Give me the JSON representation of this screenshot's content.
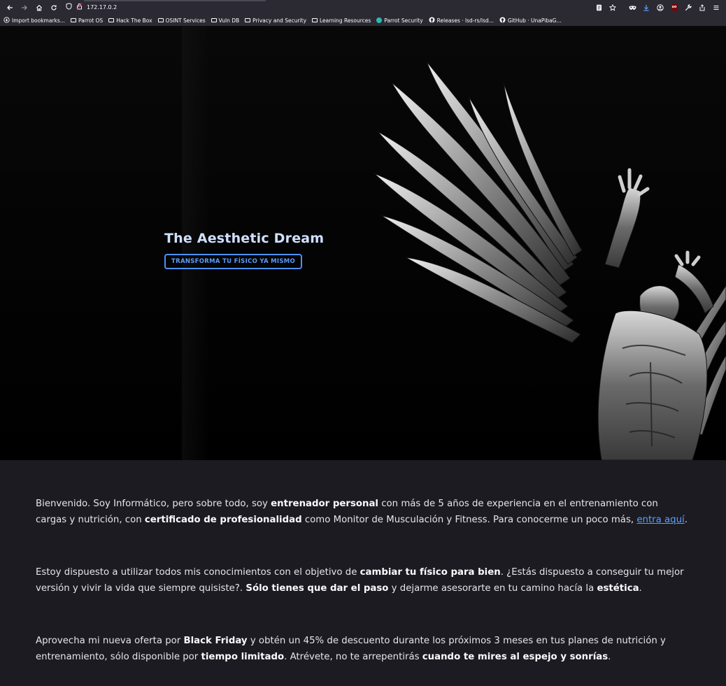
{
  "browser": {
    "url": "172.17.0.2",
    "nav": {
      "back_icon": "arrow-left-icon",
      "forward_icon": "arrow-right-icon",
      "home_icon": "home-icon",
      "reload_icon": "reload-icon"
    },
    "bookmarks": [
      {
        "label": "Import bookmarks...",
        "icon": "import-icon"
      },
      {
        "label": "Parrot OS",
        "icon": "folder-icon"
      },
      {
        "label": "Hack The Box",
        "icon": "folder-icon"
      },
      {
        "label": "OSINT Services",
        "icon": "folder-icon"
      },
      {
        "label": "Vuln DB",
        "icon": "folder-icon"
      },
      {
        "label": "Privacy and Security",
        "icon": "folder-icon"
      },
      {
        "label": "Learning Resources",
        "icon": "folder-icon"
      },
      {
        "label": "Parrot Security",
        "icon": "parrot-icon"
      },
      {
        "label": "Releases · lsd-rs/lsd...",
        "icon": "github-icon"
      },
      {
        "label": "GitHub · UnaPibaG...",
        "icon": "github-icon"
      }
    ],
    "toolbar_icons": [
      "reader-icon",
      "star-icon",
      "mask-icon",
      "download-icon",
      "account-icon",
      "ublock-icon",
      "wrench-icon",
      "share-icon",
      "menu-icon"
    ]
  },
  "hero": {
    "title": "The Aesthetic Dream",
    "cta": "TRANSFORMA TU FÍSICO YA MISMO"
  },
  "content": {
    "p1": {
      "t1": "Bienvenido. Soy Informático, pero sobre todo, soy ",
      "b1": "entrenador personal",
      "t2": " con más de 5 años de experiencia en el entrenamiento con cargas y nutrición, con ",
      "b2": "certificado de profesionalidad",
      "t3": " como Monitor de Musculación y Fitness. Para conocerme un poco más, ",
      "link": "entra aquí",
      "t4": "."
    },
    "p2": {
      "t1": "Estoy dispuesto a utilizar todos mis conocimientos con el objetivo de ",
      "b1": "cambiar tu físico para bien",
      "t2": ". ¿Estás dispuesto a conseguir tu mejor versión y vivir la vida que siempre quisiste?. ",
      "b2": "Sólo tienes que dar el paso",
      "t3": " y dejarme asesorarte en tu camino hacía la ",
      "b3": "estética",
      "t4": "."
    },
    "p3": {
      "t1": "Aprovecha mi nueva oferta por ",
      "b1": "Black Friday",
      "t2": " y obtén un 45% de descuento durante los próximos 3 meses en tus planes de nutrición y entrenamiento, sólo disponible por ",
      "b2": "tiempo limitado",
      "t3": ". Atrévete, no te arrepentirás ",
      "b3": "cuando te mires al espejo y sonrías",
      "t4": "."
    }
  }
}
